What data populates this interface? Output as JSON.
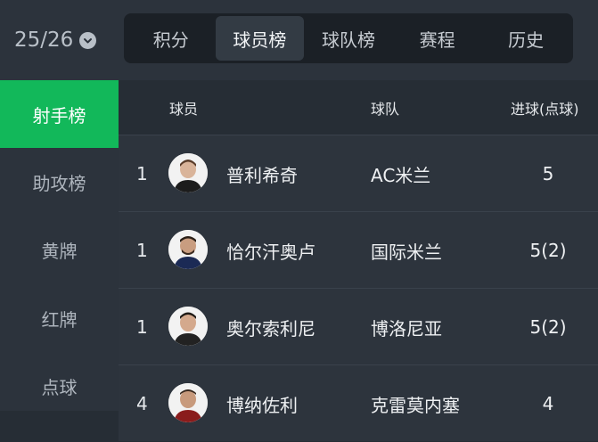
{
  "season": {
    "label": "25/26",
    "icon": "chevron-down-icon"
  },
  "tabs": [
    {
      "label": "积分",
      "active": false
    },
    {
      "label": "球员榜",
      "active": true
    },
    {
      "label": "球队榜",
      "active": false
    },
    {
      "label": "赛程",
      "active": false
    },
    {
      "label": "历史",
      "active": false
    }
  ],
  "sidebar": {
    "items": [
      {
        "label": "射手榜",
        "active": true
      },
      {
        "label": "助攻榜",
        "active": false
      },
      {
        "label": "黄牌",
        "active": false
      },
      {
        "label": "红牌",
        "active": false
      },
      {
        "label": "点球",
        "active": false
      }
    ]
  },
  "table": {
    "headers": {
      "player": "球员",
      "team": "球队",
      "goals": "进球(点球)"
    },
    "rows": [
      {
        "rank": "1",
        "player": "普利希奇",
        "team": "AC米兰",
        "goals": "5"
      },
      {
        "rank": "1",
        "player": "恰尔汗奥卢",
        "team": "国际米兰",
        "goals": "5(2)"
      },
      {
        "rank": "1",
        "player": "奥尔索利尼",
        "team": "博洛尼亚",
        "goals": "5(2)"
      },
      {
        "rank": "4",
        "player": "博纳佐利",
        "team": "克雷莫内塞",
        "goals": "4"
      }
    ]
  },
  "colors": {
    "accent": "#12b85a",
    "background": "#262d35",
    "panel": "#2c333c"
  }
}
